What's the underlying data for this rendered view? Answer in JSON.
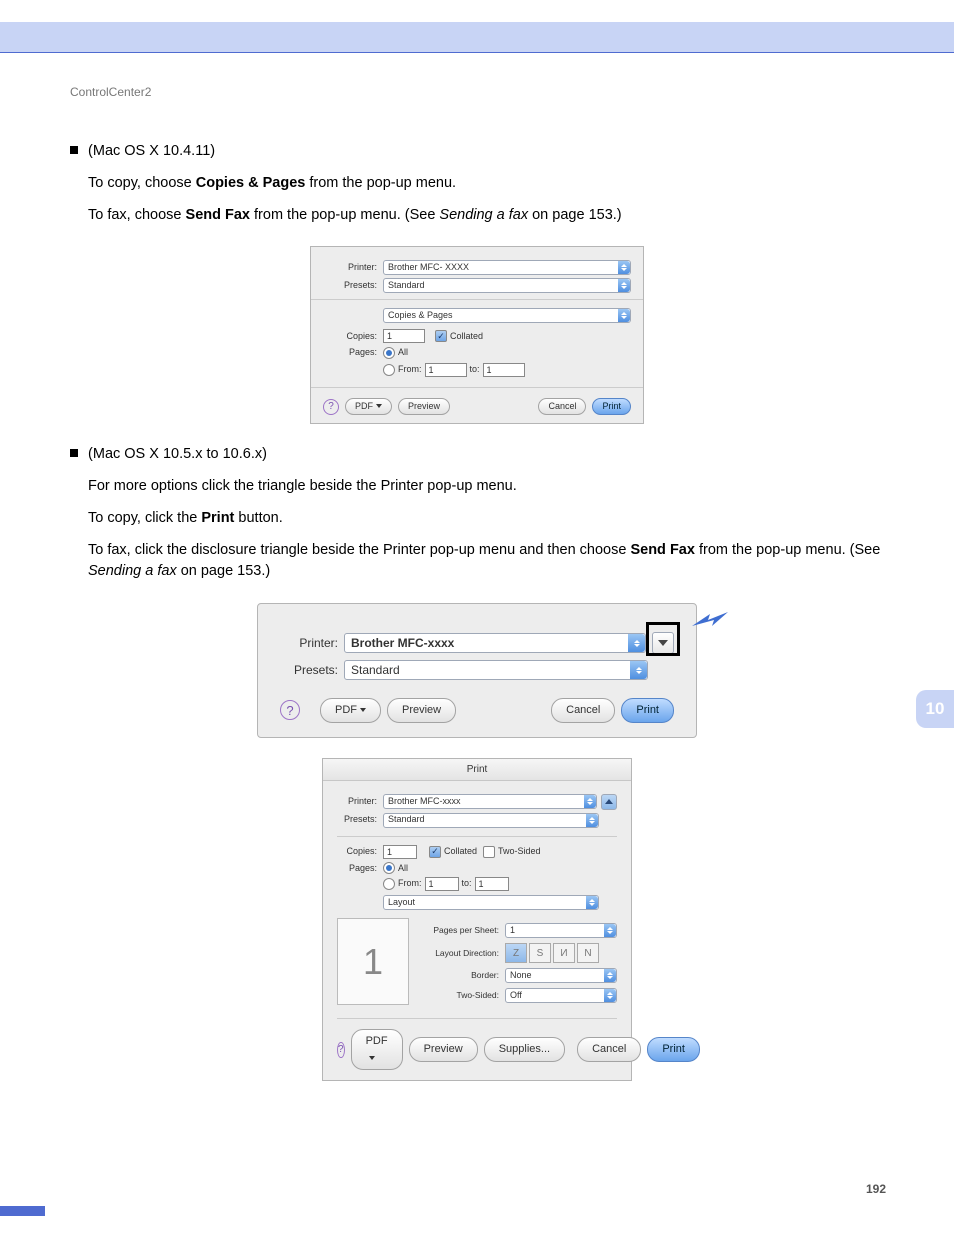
{
  "breadcrumb": "ControlCenter2",
  "section1": {
    "heading": "(Mac OS X 10.4.11)",
    "p1_a": "To copy, choose ",
    "p1_b": "Copies & Pages",
    "p1_c": " from the pop-up menu.",
    "p2_a": "To fax, choose ",
    "p2_b": "Send Fax",
    "p2_c": " from the pop-up menu. (See ",
    "p2_d": "Sending a fax",
    "p2_e": " on page 153.)"
  },
  "dlg1": {
    "printer_lbl": "Printer:",
    "printer_val": "Brother MFC- XXXX",
    "presets_lbl": "Presets:",
    "presets_val": "Standard",
    "section_val": "Copies & Pages",
    "copies_lbl": "Copies:",
    "copies_val": "1",
    "collated": "Collated",
    "pages_lbl": "Pages:",
    "all": "All",
    "from": "From:",
    "from_val": "1",
    "to": "to:",
    "to_val": "1",
    "help": "?",
    "pdf": "PDF",
    "preview": "Preview",
    "cancel": "Cancel",
    "print": "Print"
  },
  "section2": {
    "heading": "(Mac OS X 10.5.x to 10.6.x)",
    "p1": "For more options click the triangle beside the Printer pop-up menu.",
    "p2_a": "To copy, click the ",
    "p2_b": "Print",
    "p2_c": " button.",
    "p3_a": "To fax, click the disclosure triangle beside the Printer pop-up menu and then choose ",
    "p3_b": "Send Fax",
    "p3_c": " from the pop-up menu. (See ",
    "p3_d": "Sending a fax",
    "p3_e": " on page 153.)"
  },
  "dlg2": {
    "printer_lbl": "Printer:",
    "printer_val": "Brother MFC-xxxx",
    "presets_lbl": "Presets:",
    "presets_val": "Standard",
    "help": "?",
    "pdf": "PDF",
    "preview": "Preview",
    "cancel": "Cancel",
    "print": "Print"
  },
  "dlg3": {
    "title": "Print",
    "printer_lbl": "Printer:",
    "printer_val": "Brother MFC-xxxx",
    "presets_lbl": "Presets:",
    "presets_val": "Standard",
    "copies_lbl": "Copies:",
    "copies_val": "1",
    "collated": "Collated",
    "twosided_chk": "Two-Sided",
    "pages_lbl": "Pages:",
    "all": "All",
    "from": "From:",
    "from_val": "1",
    "to": "to:",
    "to_val": "1",
    "section_val": "Layout",
    "pps_lbl": "Pages per Sheet:",
    "pps_val": "1",
    "dir_lbl": "Layout Direction:",
    "border_lbl": "Border:",
    "border_val": "None",
    "ts_lbl": "Two-Sided:",
    "ts_val": "Off",
    "preview_digit": "1",
    "help": "?",
    "pdf": "PDF",
    "preview": "Preview",
    "supplies": "Supplies...",
    "cancel": "Cancel",
    "print": "Print"
  },
  "side_tab": "10",
  "page_num": "192"
}
